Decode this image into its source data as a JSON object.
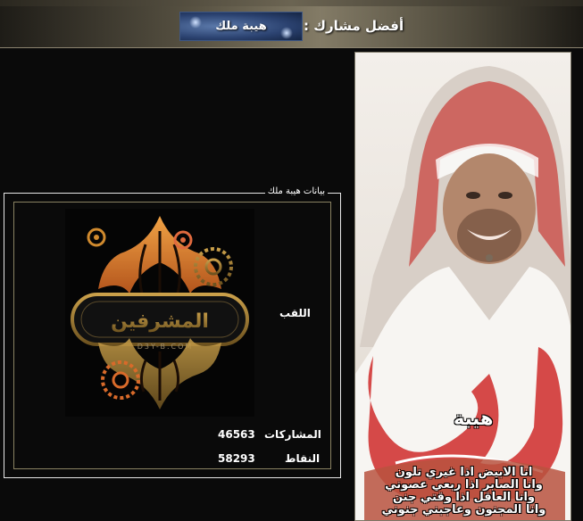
{
  "header": {
    "title": "أفضل مشارك :",
    "member_name": "هيبة ملك"
  },
  "profile": {
    "legend": "بيانات هيبة ملك",
    "logo_text": "المشرفين",
    "logo_url_text": "D3Y-B.COM",
    "fields": [
      {
        "label": "اللقب",
        "value": ""
      },
      {
        "label": "المشاركات",
        "value": "46563"
      },
      {
        "label": "النقاط",
        "value": "58293"
      }
    ]
  },
  "poster": {
    "tag": "هيبة",
    "lines": [
      "انا الابيض اذا غيري تلون",
      "وانا الصابر اذا ربعي عصوني",
      "وانا العاقل اذا وقتي جنن",
      "وانا المجنون وعاجبني جنوني"
    ]
  },
  "colors": {
    "background": "#0a0a0a",
    "header_gold": "#837b66",
    "border_gold": "#8a8262",
    "logo_orange": "#e07a2a"
  }
}
